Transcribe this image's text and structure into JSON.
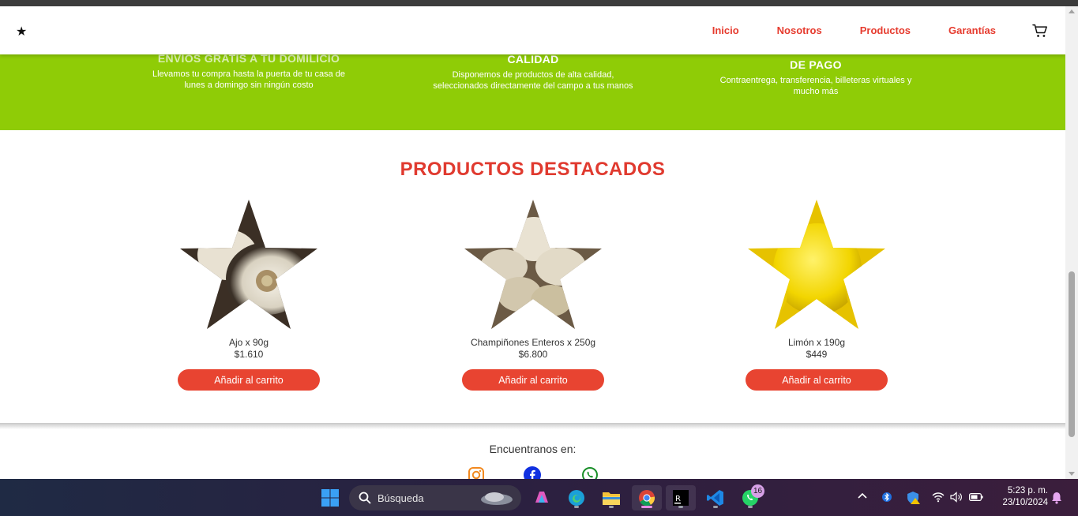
{
  "nav": {
    "logo": "★",
    "links": [
      "Inicio",
      "Nosotros",
      "Productos",
      "Garantías"
    ],
    "cart_icon": "cart-icon"
  },
  "features": [
    {
      "title": "ENVIOS GRATIS A TU DOMILICIO",
      "desc": "Llevamos tu compra hasta la puerta de tu casa de lunes a domingo sin ningún costo"
    },
    {
      "title": "CALIDAD",
      "desc": "Disponemos de productos de alta calidad, seleccionados directamente del campo a tus manos"
    },
    {
      "title": "DE PAGO",
      "desc": "Contraentrega, transferencia, billeteras virtuales y mucho más"
    }
  ],
  "products_section": {
    "title": "PRODUCTOS DESTACADOS",
    "items": [
      {
        "name": "Ajo x 90g",
        "price": "$1.610",
        "button": "Añadir al carrito"
      },
      {
        "name": "Champiñones Enteros x 250g",
        "price": "$6.800",
        "button": "Añadir al carrito"
      },
      {
        "name": "Limón x 190g",
        "price": "$449",
        "button": "Añadir al carrito"
      }
    ]
  },
  "footer": {
    "title": "Encuentranos en:",
    "socials": [
      "instagram-icon",
      "facebook-icon",
      "whatsapp-icon"
    ]
  },
  "taskbar": {
    "search_placeholder": "Búsqueda",
    "whatsapp_badge": "16",
    "time": "5:23 p. m.",
    "date": "23/10/2024"
  },
  "colors": {
    "brand_red": "#e03a2f",
    "band_green": "#8fcc06"
  }
}
